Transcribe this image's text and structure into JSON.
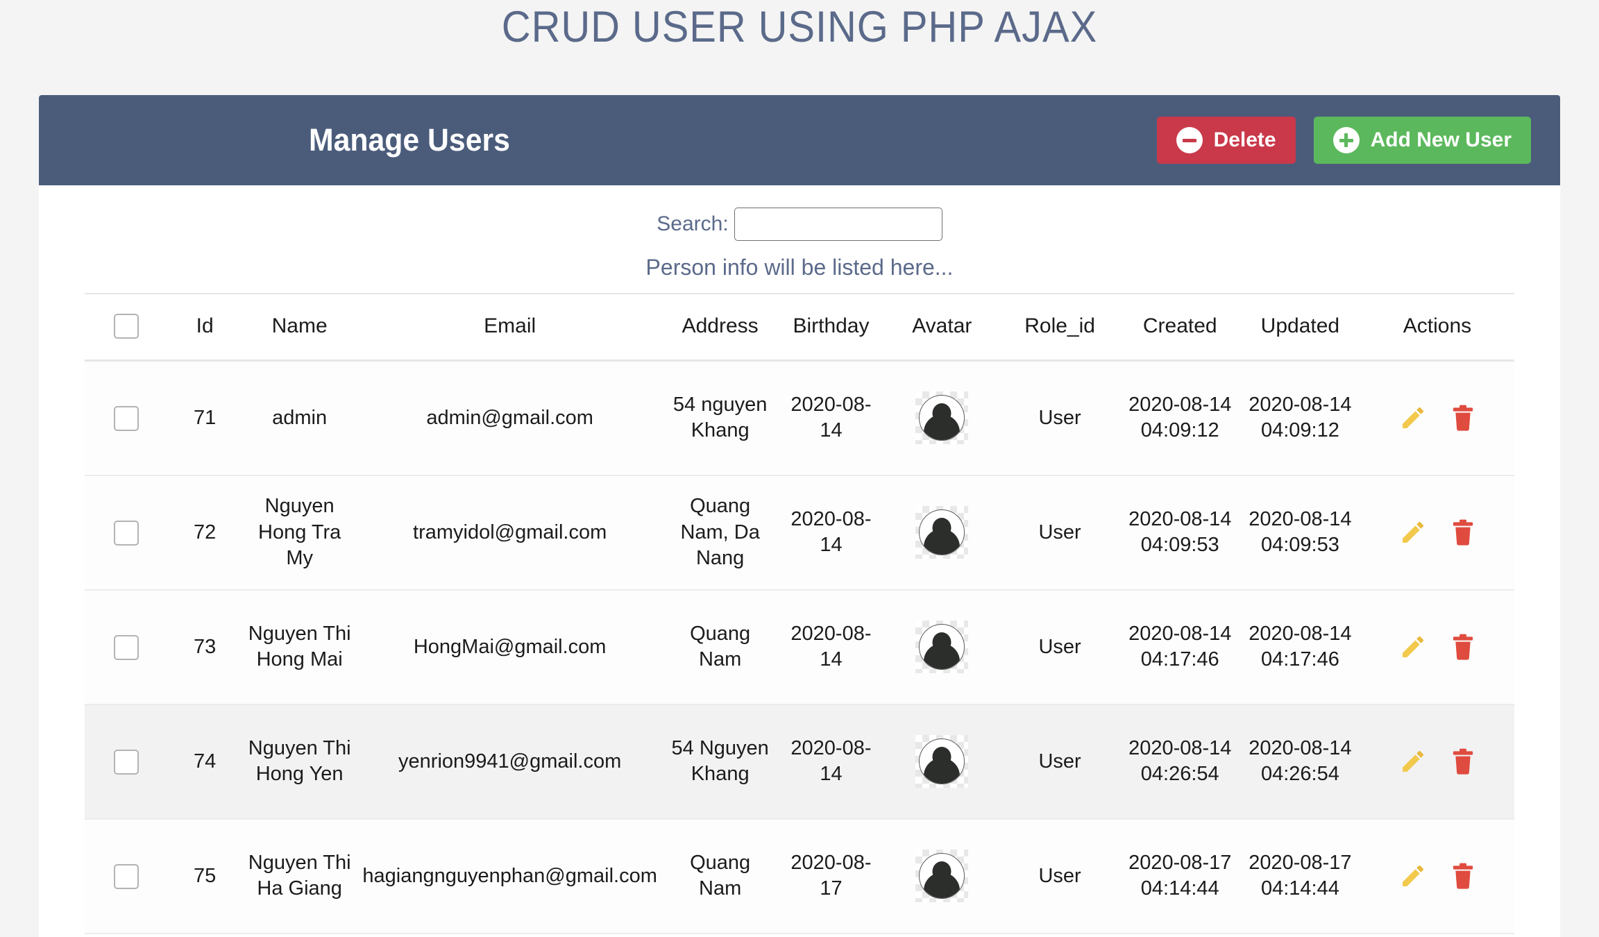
{
  "page": {
    "title": "CRUD USER USING PHP AJAX",
    "background_color": "#f4f4f4",
    "title_color": "#5b6a8a"
  },
  "card": {
    "header": {
      "title": "Manage Users",
      "background_color": "#4b5c7b",
      "buttons": [
        {
          "label": "Delete",
          "icon": "minus-circle-icon",
          "color": "#c9394a"
        },
        {
          "label": "Add New User",
          "icon": "plus-circle-icon",
          "color": "#5cb85c"
        }
      ]
    },
    "search": {
      "label": "Search:",
      "value": "",
      "placeholder": ""
    },
    "listing_note": "Person info will be listed here..."
  },
  "table": {
    "columns": [
      "",
      "Id",
      "Name",
      "Email",
      "Address",
      "Birthday",
      "Avatar",
      "Role_id",
      "Created",
      "Updated",
      "Actions"
    ],
    "select_all_checked": false,
    "action_icons": {
      "edit": "pencil-icon",
      "delete": "trash-icon",
      "edit_color": "#f2c94c",
      "delete_color": "#e04b3f"
    },
    "rows": [
      {
        "checked": false,
        "id": "71",
        "name": "admin",
        "email": "admin@gmail.com",
        "address": "54 nguyen Khang",
        "birthday": "2020-08-14",
        "avatar": "default-user-avatar",
        "role_id": "User",
        "created": "2020-08-14 04:09:12",
        "updated": "2020-08-14 04:09:12"
      },
      {
        "checked": false,
        "id": "72",
        "name": "Nguyen Hong Tra My",
        "email": "tramyidol@gmail.com",
        "address": "Quang Nam, Da Nang",
        "birthday": "2020-08-14",
        "avatar": "default-user-avatar",
        "role_id": "User",
        "created": "2020-08-14 04:09:53",
        "updated": "2020-08-14 04:09:53"
      },
      {
        "checked": false,
        "id": "73",
        "name": "Nguyen Thi Hong Mai",
        "email": "HongMai@gmail.com",
        "address": "Quang Nam",
        "birthday": "2020-08-14",
        "avatar": "default-user-avatar",
        "role_id": "User",
        "created": "2020-08-14 04:17:46",
        "updated": "2020-08-14 04:17:46"
      },
      {
        "checked": false,
        "id": "74",
        "name": "Nguyen Thi Hong Yen",
        "email": "yenrion9941@gmail.com",
        "address": "54 Nguyen Khang",
        "birthday": "2020-08-14",
        "avatar": "default-user-avatar",
        "role_id": "User",
        "created": "2020-08-14 04:26:54",
        "updated": "2020-08-14 04:26:54"
      },
      {
        "checked": false,
        "id": "75",
        "name": "Nguyen Thi Ha Giang",
        "email": "hagiangnguyenphan@gmail.com",
        "address": "Quang Nam",
        "birthday": "2020-08-17",
        "avatar": "default-user-avatar",
        "role_id": "User",
        "created": "2020-08-17 04:14:44",
        "updated": "2020-08-17 04:14:44"
      }
    ]
  }
}
